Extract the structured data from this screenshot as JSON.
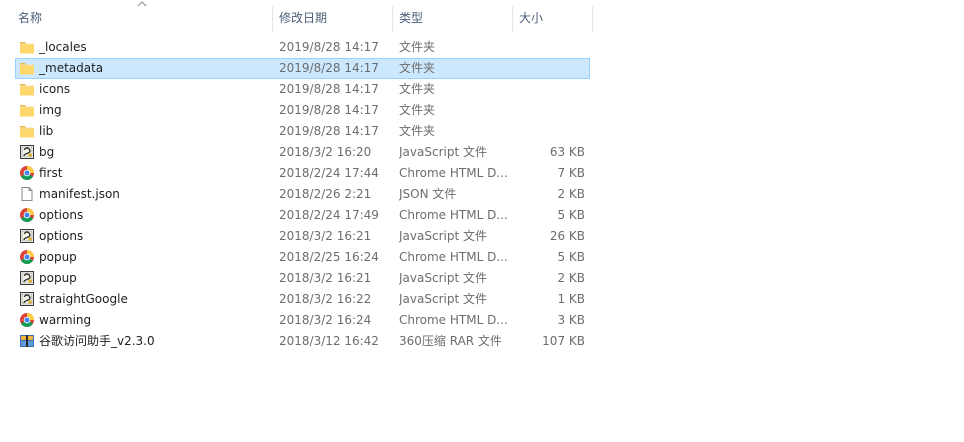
{
  "header": {
    "name": "名称",
    "date": "修改日期",
    "type": "类型",
    "size": "大小"
  },
  "rows": [
    {
      "icon": "folder",
      "name": "_locales",
      "date": "2019/8/28 14:17",
      "type": "文件夹",
      "size": ""
    },
    {
      "icon": "folder",
      "name": "_metadata",
      "date": "2019/8/28 14:17",
      "type": "文件夹",
      "size": ""
    },
    {
      "icon": "folder",
      "name": "icons",
      "date": "2019/8/28 14:17",
      "type": "文件夹",
      "size": ""
    },
    {
      "icon": "folder",
      "name": "img",
      "date": "2019/8/28 14:17",
      "type": "文件夹",
      "size": ""
    },
    {
      "icon": "folder",
      "name": "lib",
      "date": "2019/8/28 14:17",
      "type": "文件夹",
      "size": ""
    },
    {
      "icon": "script",
      "name": "bg",
      "date": "2018/3/2 16:20",
      "type": "JavaScript 文件",
      "size": "63 KB"
    },
    {
      "icon": "chrome",
      "name": "first",
      "date": "2018/2/24 17:44",
      "type": "Chrome HTML D...",
      "size": "7 KB"
    },
    {
      "icon": "file",
      "name": "manifest.json",
      "date": "2018/2/26 2:21",
      "type": "JSON 文件",
      "size": "2 KB"
    },
    {
      "icon": "chrome",
      "name": "options",
      "date": "2018/2/24 17:49",
      "type": "Chrome HTML D...",
      "size": "5 KB"
    },
    {
      "icon": "script",
      "name": "options",
      "date": "2018/3/2 16:21",
      "type": "JavaScript 文件",
      "size": "26 KB"
    },
    {
      "icon": "chrome",
      "name": "popup",
      "date": "2018/2/25 16:24",
      "type": "Chrome HTML D...",
      "size": "5 KB"
    },
    {
      "icon": "script",
      "name": "popup",
      "date": "2018/3/2 16:21",
      "type": "JavaScript 文件",
      "size": "2 KB"
    },
    {
      "icon": "script",
      "name": "straightGoogle",
      "date": "2018/3/2 16:22",
      "type": "JavaScript 文件",
      "size": "1 KB"
    },
    {
      "icon": "chrome",
      "name": "warming",
      "date": "2018/3/2 16:24",
      "type": "Chrome HTML D...",
      "size": "3 KB"
    },
    {
      "icon": "rar",
      "name": "谷歌访问助手_v2.3.0",
      "date": "2018/3/12 16:42",
      "type": "360压缩 RAR 文件",
      "size": "107 KB"
    }
  ],
  "selected_row": 1,
  "colors": {
    "selection_bg": "#cce8ff",
    "selection_border": "#99d1ff",
    "header_text": "#4c607a",
    "folder": "#ffd76a"
  }
}
